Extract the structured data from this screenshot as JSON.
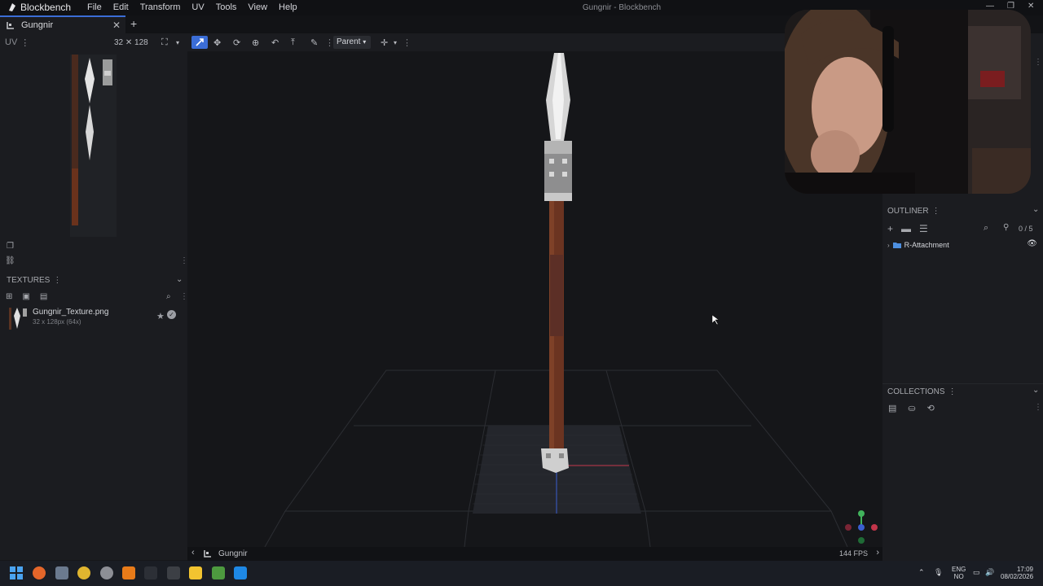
{
  "app": {
    "name": "Blockbench",
    "window_title": "Gungnir - Blockbench",
    "menu": [
      "File",
      "Edit",
      "Transform",
      "UV",
      "Tools",
      "View",
      "Help"
    ]
  },
  "tabs": [
    {
      "label": "Gungnir"
    }
  ],
  "uv_panel": {
    "label": "UV",
    "texture_size": "32 ✕ 128"
  },
  "toolbar": {
    "pivot_mode": "Parent"
  },
  "textures_panel": {
    "label": "TEXTURES",
    "items": [
      {
        "name": "Gungnir_Texture.png",
        "size": "32 x 128px (64x)"
      }
    ]
  },
  "outliner": {
    "label": "OUTLINER",
    "count": "0 / 5",
    "items": [
      {
        "name": "R-Attachment"
      }
    ]
  },
  "collections": {
    "label": "COLLECTIONS"
  },
  "statusbar": {
    "model_name": "Gungnir",
    "fps": "144 FPS"
  },
  "taskbar": {
    "lang_top": "ENG",
    "lang_bottom": "NO",
    "time": "17:09",
    "date": "08/02/2026"
  },
  "icons": {
    "close": "close-icon",
    "add": "plus-icon",
    "search": "search-icon",
    "eye": "eye-icon",
    "folder": "folder-icon"
  },
  "colors": {
    "accent": "#3b6dd6",
    "panel": "#1b1c20",
    "viewport": "#151619"
  }
}
